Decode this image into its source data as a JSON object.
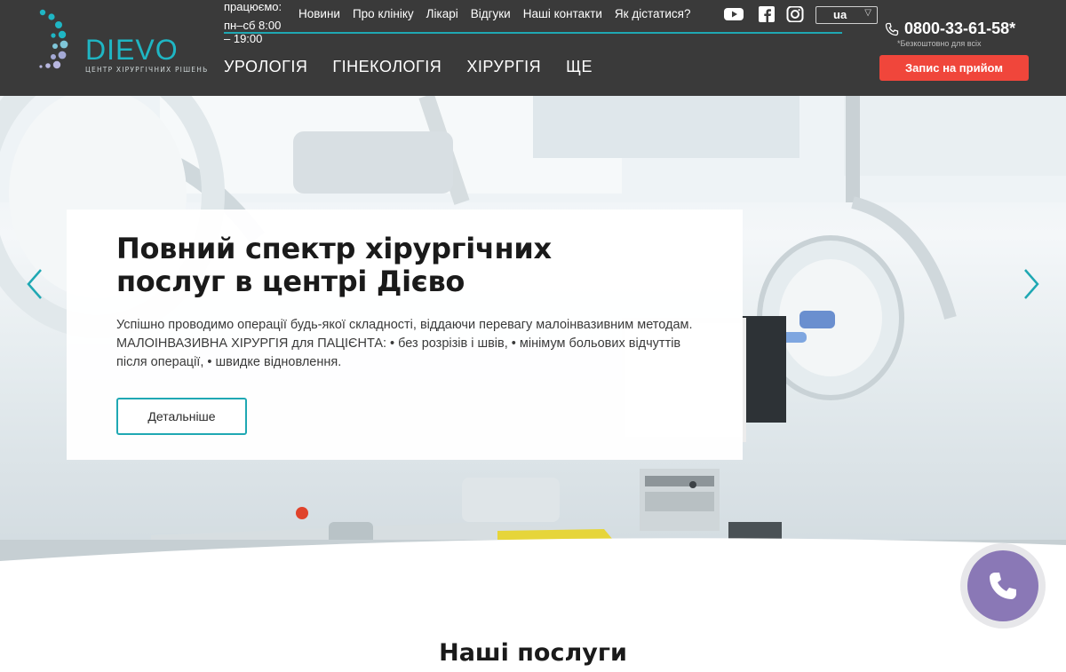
{
  "brand": {
    "name": "DIEVO",
    "tagline": "ЦЕНТР ХІРУРГІЧНИХ РІШЕНЬ",
    "accent": "#1fb6c4"
  },
  "header": {
    "hours_label": "працюємо:",
    "hours_days": "пн–сб 8:00",
    "hours_time": "– 19:00",
    "top_nav": [
      "Новини",
      "Про клініку",
      "Лікарі",
      "Відгуки",
      "Наші контакти",
      "Як дістатися?"
    ],
    "social": [
      "youtube-icon",
      "facebook-icon",
      "instagram-icon"
    ],
    "language": "ua",
    "main_nav": [
      "УРОЛОГІЯ",
      "ГІНЕКОЛОГІЯ",
      "ХІРУРГІЯ",
      "ЩЕ"
    ],
    "phone": "0800-33-61-58*",
    "phone_note": "*Безкоштовно для всіх",
    "cta_label": "Запис на прийом",
    "cta_color": "#f0463b",
    "background": "#3a3a3a"
  },
  "hero": {
    "title": "Повний спектр хірургічних послуг в центрі Дієво",
    "description": "Успішно проводимо операції будь-якої складності, віддаючи перевагу малоінвазивним методам. МАЛОІНВАЗИВНА ХІРУРГІЯ для ПАЦІЄНТА: • без розрізів і швів, • мінімум больових відчуттів після операції, • швидке відновлення.",
    "button_label": "Детальніше",
    "prev_icon": "chevron-left-icon",
    "next_icon": "chevron-right-icon"
  },
  "call_button": {
    "icon": "phone-icon",
    "color": "#8a78b6"
  },
  "services": {
    "title": "Наші послуги"
  }
}
